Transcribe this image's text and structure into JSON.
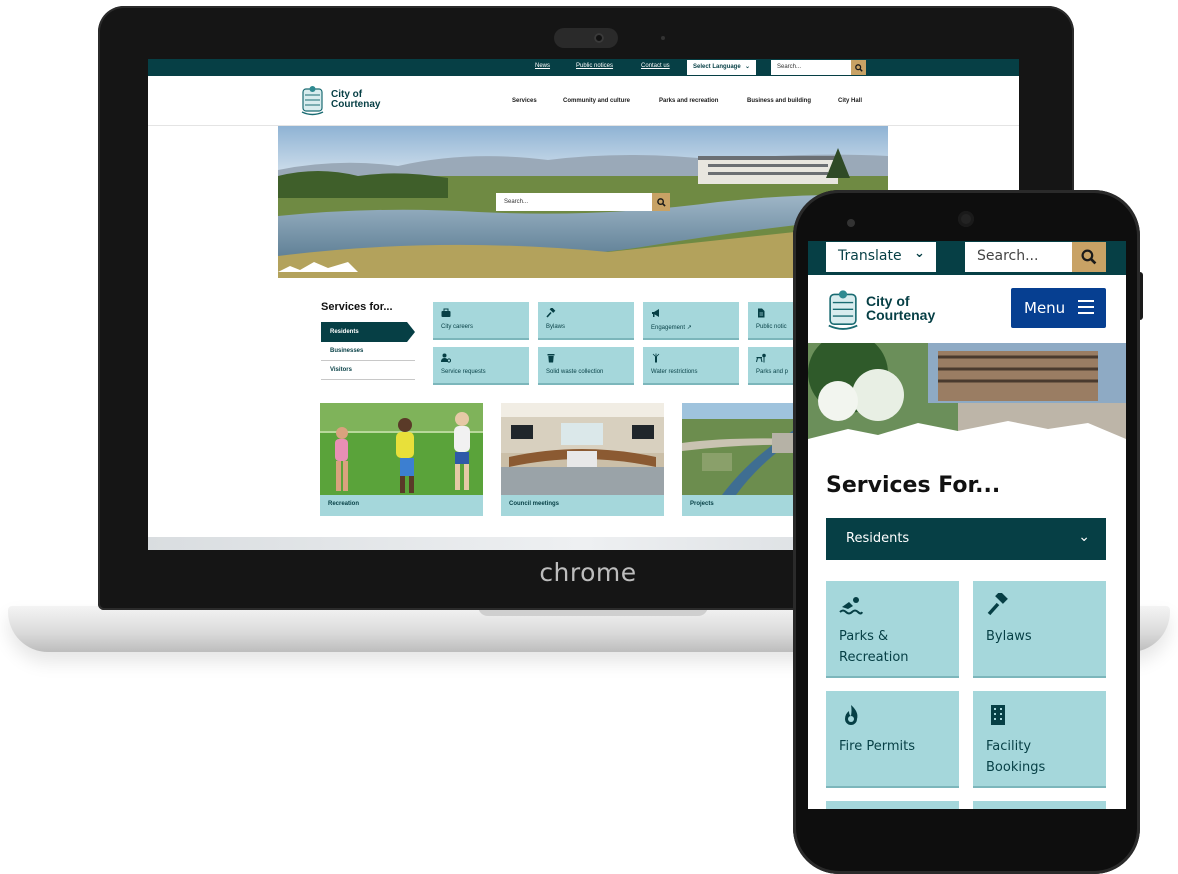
{
  "laptop": {
    "brand": "chrome"
  },
  "desktop": {
    "util_links": [
      "News",
      "Public notices",
      "Contact us"
    ],
    "language_select": "Select Language",
    "search_placeholder": "Search...",
    "logo": {
      "line1": "City of",
      "line2": "Courtenay"
    },
    "nav": [
      "Services",
      "Community and culture",
      "Parks and recreation",
      "Business and building",
      "City Hall"
    ],
    "hero_search_placeholder": "Search...",
    "services": {
      "title": "Services for...",
      "audiences": [
        "Residents",
        "Businesses",
        "Visitors"
      ],
      "tiles": [
        {
          "label": "City careers",
          "icon": "briefcase-icon"
        },
        {
          "label": "Bylaws",
          "icon": "gavel-icon"
        },
        {
          "label": "Engagement",
          "icon": "megaphone-icon",
          "external": true
        },
        {
          "label": "Public notic",
          "icon": "document-icon"
        },
        {
          "label": "Service requests",
          "icon": "user-gear-icon"
        },
        {
          "label": "Solid waste collection",
          "icon": "trash-icon"
        },
        {
          "label": "Water restrictions",
          "icon": "sprinkler-icon"
        },
        {
          "label": "Parks and p",
          "icon": "picnic-icon"
        }
      ]
    },
    "cards": [
      "Recreation",
      "Council meetings",
      "Projects"
    ]
  },
  "mobile": {
    "translate": "Translate",
    "search_placeholder": "Search...",
    "logo": {
      "line1": "City of",
      "line2": "Courtenay"
    },
    "menu_label": "Menu",
    "services_title": "Services For...",
    "audience_selected": "Residents",
    "tiles": [
      {
        "line1": "Parks &",
        "line2": "Recreation",
        "icon": "swimmer-icon"
      },
      {
        "line1": "Bylaws",
        "line2": "",
        "icon": "gavel-icon"
      },
      {
        "line1": "Fire Permits",
        "line2": "",
        "icon": "fire-icon"
      },
      {
        "line1": "Facility",
        "line2": "Bookings",
        "icon": "building-icon"
      }
    ]
  },
  "colors": {
    "teal_dark": "#063f45",
    "tile": "#a5d7db",
    "gold": "#c8a265",
    "menu_blue": "#063f91"
  }
}
